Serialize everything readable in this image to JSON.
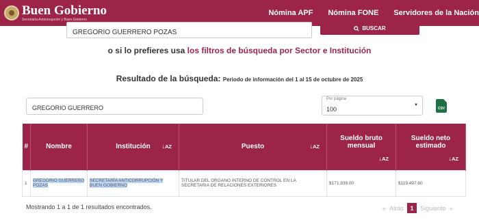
{
  "header": {
    "logo_title": "Buen Gobierno",
    "logo_subtitle": "Secretaría Anticorrupción y Buen Gobierno",
    "nav": [
      "Nómina APF",
      "Nómina FONE",
      "Servidores de la Nación"
    ]
  },
  "search": {
    "value": "GREGORIO GUERRERO POZAS",
    "button_label": "BUSCAR"
  },
  "filters_text": {
    "prefix": "o si lo prefieres usa ",
    "link": "los filtros de búsqueda por Sector e Institución"
  },
  "result": {
    "title": "Resultado de la búsqueda:",
    "period": "Periodo de información del 1 al 15 de octubre de 2025"
  },
  "filter_input": {
    "value": "GREGORIO GUERRERO"
  },
  "per_page": {
    "label": "Por página",
    "value": "100"
  },
  "csv_label": "CSV",
  "table": {
    "headers": [
      "#",
      "Nombre",
      "Institución",
      "Puesto",
      "Sueldo bruto mensual",
      "Sueldo neto estimado"
    ],
    "rows": [
      {
        "num": "1",
        "nombre": "GREGORIO GUERRERO POZAS",
        "institucion": "SECRETARÍA ANTICORRUPCIÓN Y BUEN GOBIERNO",
        "puesto": "TITULAR DEL ORGANO INTERNO DE CONTROL EN LA SECRETARIA DE RELACIONES EXTERIORES",
        "bruto": "$171,939.00",
        "neto": "$119,497.60"
      }
    ]
  },
  "footer": {
    "summary": "Mostrando 1 a 1 de 1 resultados encontrados.",
    "first": "«",
    "prev": "Atrás",
    "page": "1",
    "next": "Siguiente",
    "last": "»"
  },
  "colors": {
    "brand": "#9d2449",
    "highlight": "#bcd6f5",
    "csv": "#1e7145"
  }
}
